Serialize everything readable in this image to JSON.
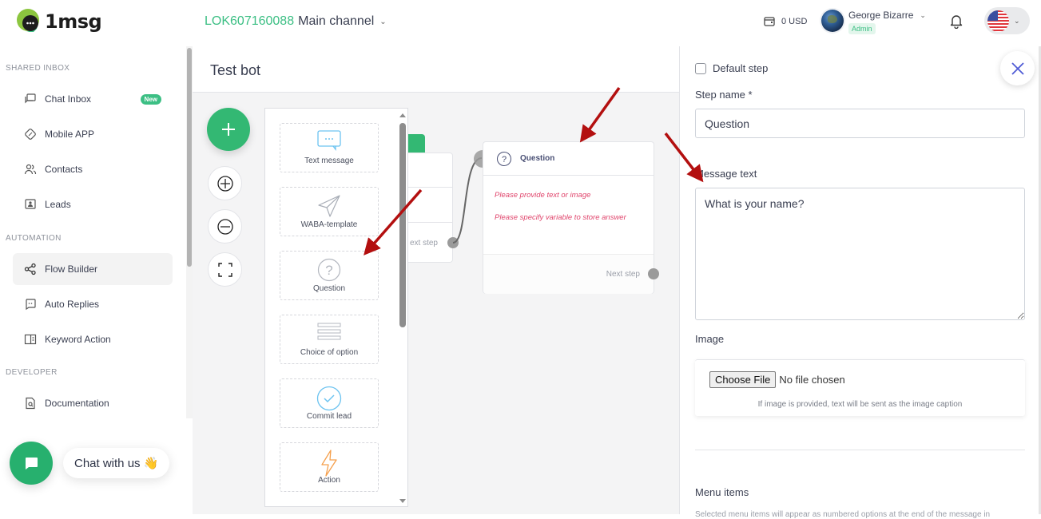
{
  "header": {
    "logo_text": "1msg",
    "channel_id": "LOK607160088",
    "channel_name": "Main channel",
    "balance": "0 USD",
    "user_name": "George Bizarre",
    "user_role": "Admin"
  },
  "sidebar": {
    "sections": [
      {
        "label": "SHARED INBOX",
        "items": [
          {
            "label": "Chat Inbox",
            "icon": "chat-inbox-icon",
            "badge": "New"
          },
          {
            "label": "Mobile APP",
            "icon": "mobile-app-icon"
          },
          {
            "label": "Contacts",
            "icon": "contacts-icon"
          },
          {
            "label": "Leads",
            "icon": "leads-icon"
          }
        ]
      },
      {
        "label": "AUTOMATION",
        "items": [
          {
            "label": "Flow Builder",
            "icon": "flow-builder-icon",
            "active": true
          },
          {
            "label": "Auto Replies",
            "icon": "auto-replies-icon"
          },
          {
            "label": "Keyword Action",
            "icon": "keyword-action-icon"
          }
        ]
      },
      {
        "label": "DEVELOPER",
        "items": [
          {
            "label": "Documentation",
            "icon": "documentation-icon"
          }
        ]
      }
    ],
    "chat_widget_label": "Chat with us 👋"
  },
  "main": {
    "title": "Test bot",
    "palette": [
      {
        "label": "Text message",
        "icon": "text-message-icon"
      },
      {
        "label": "WABA-template",
        "icon": "send-icon"
      },
      {
        "label": "Question",
        "icon": "question-icon"
      },
      {
        "label": "Choice of option",
        "icon": "list-icon"
      },
      {
        "label": "Commit lead",
        "icon": "check-circle-icon"
      },
      {
        "label": "Action",
        "icon": "lightning-icon"
      }
    ],
    "prev_node_next_step": "ext step",
    "question_node": {
      "title": "Question",
      "errors": [
        "Please provide text or image",
        "Please specify variable to store answer"
      ],
      "next_step": "Next step"
    }
  },
  "panel": {
    "default_step_label": "Default step",
    "default_step_checked": false,
    "step_name_label": "Step name *",
    "step_name_value": "Question",
    "message_text_label": "Message text",
    "message_text_value": "What is your name?",
    "image_label": "Image",
    "choose_file_label": "Choose File",
    "no_file_label": "No file chosen",
    "image_hint": "If image is provided, text will be sent as the image caption",
    "menu_items_label": "Menu items",
    "menu_items_hint": "Selected menu items will appear as numbered options at the end of the message in"
  },
  "colors": {
    "brand_green": "#33b873",
    "error_pink": "#e0456c",
    "close_blue": "#4f5bd5",
    "annotation_red": "#b30f0f"
  }
}
